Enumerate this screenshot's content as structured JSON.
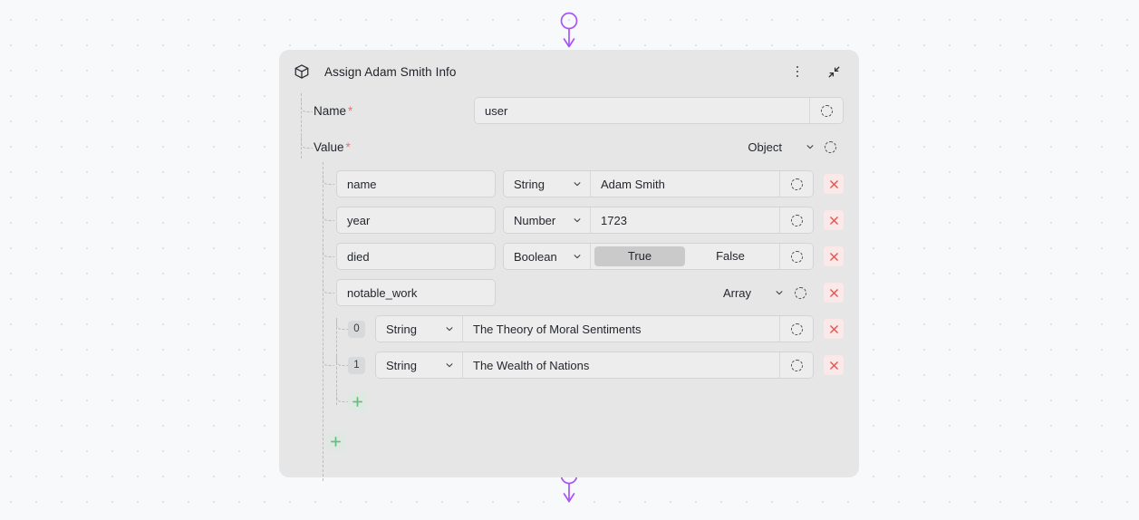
{
  "canvas": {
    "background_color": "#f8f9fa",
    "dot_color": "#e0e2e5"
  },
  "connectors": {
    "color": "#a855f7",
    "top_name": "input-connector",
    "bottom_name": "output-connector"
  },
  "node": {
    "icon": "cube-icon",
    "title": "Assign Adam Smith Info",
    "menu_icon": "more-vertical-icon",
    "collapse_icon": "collapse-icon",
    "panel_color": "#e6e6e6"
  },
  "fields": {
    "name": {
      "label": "Name",
      "required_marker": "*",
      "value": "user",
      "placeholder": "",
      "variable_icon": "dashed-circle-icon"
    },
    "value": {
      "label": "Value",
      "required_marker": "*",
      "type": "Object",
      "chevron_icon": "chevron-down-icon",
      "variable_icon": "dashed-circle-icon"
    }
  },
  "properties": [
    {
      "key": "name",
      "type": "String",
      "value": "Adam Smith",
      "kind": "text",
      "variable_icon": "dashed-circle-icon",
      "delete_icon": "close-icon"
    },
    {
      "key": "year",
      "type": "Number",
      "value": "1723",
      "kind": "text",
      "variable_icon": "dashed-circle-icon",
      "delete_icon": "close-icon"
    },
    {
      "key": "died",
      "type": "Boolean",
      "value": "True",
      "kind": "boolean",
      "options": [
        "True",
        "False"
      ],
      "selected": "True",
      "variable_icon": "dashed-circle-icon",
      "delete_icon": "close-icon"
    },
    {
      "key": "notable_work",
      "type": "Array",
      "kind": "array",
      "variable_icon": "dashed-circle-icon",
      "delete_icon": "close-icon",
      "items": [
        {
          "index": "0",
          "type": "String",
          "value": "The Theory of Moral Sentiments",
          "variable_icon": "dashed-circle-icon",
          "delete_icon": "close-icon"
        },
        {
          "index": "1",
          "type": "String",
          "value": "The Wealth of Nations",
          "variable_icon": "dashed-circle-icon",
          "delete_icon": "close-icon"
        }
      ],
      "add_label": "+",
      "add_icon": "plus-icon"
    }
  ],
  "add_property": {
    "label": "+",
    "icon": "plus-icon",
    "color": "#6bbd86"
  }
}
